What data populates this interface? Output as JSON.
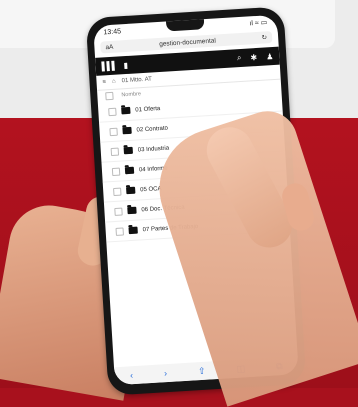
{
  "status_bar": {
    "time": "13:45",
    "indicators": "ıl ≈ ▭"
  },
  "url_bar": {
    "left": "aA",
    "url": "gestion-documental",
    "reload": "↻"
  },
  "breadcrumb": {
    "text": "01 Mtto. AT"
  },
  "column_header": "Nombre",
  "folders": [
    {
      "label": "01 Oferta"
    },
    {
      "label": "02 Contrato"
    },
    {
      "label": "03 Industria"
    },
    {
      "label": "04 Informe"
    },
    {
      "label": "05 OCA"
    },
    {
      "label": "06 Doc. Técnica"
    },
    {
      "label": "07 Partes de Trabajo"
    }
  ],
  "bottom_bar": {
    "back": "‹",
    "forward": "›",
    "share": "⇧",
    "book": "◫",
    "tabs": "⧉"
  }
}
